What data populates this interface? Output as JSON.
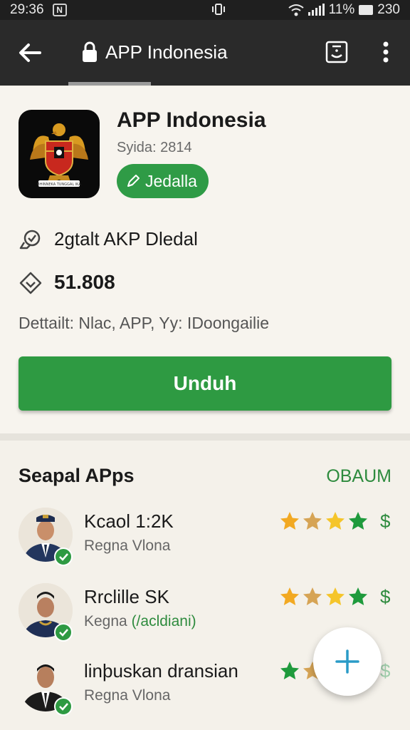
{
  "status_bar": {
    "time": "29:36",
    "notif_letter": "N",
    "battery_percent": "11%",
    "clock_right": "230"
  },
  "app_bar": {
    "title": "APP Indonesia",
    "icons": [
      "back-arrow-icon",
      "lock-icon",
      "share-icon",
      "more-vert-icon"
    ]
  },
  "app": {
    "name": "APP Indonesia",
    "size": "Syida: 2814",
    "verified_label": "Jedalla",
    "developer": "2gtalt  AKP Dledal",
    "downloads": "51.808",
    "details": "Dettailt: Nlac, APP, Yy: IDoongailie",
    "download_button": "Unduh",
    "icon_caption": "BHINNEKA TUNGGAL IKA"
  },
  "similar": {
    "title": "Seapal APps",
    "see_all": "OBAUM",
    "items": [
      {
        "name": "Kcaol 1:2K",
        "subtitle": "Regna Vlona",
        "subtitle_green": false,
        "price": "$",
        "rating": 3.5
      },
      {
        "name": "Rrclille SK",
        "subtitle_prefix": "Kegna ",
        "subtitle_green_part": "(/acldiani)",
        "price": "$",
        "rating": 3.5
      },
      {
        "name": "linþuskan dransian",
        "subtitle": "Regna Vlona",
        "subtitle_green": false,
        "price": "$",
        "rating": 1.5
      }
    ]
  },
  "colors": {
    "primary_green": "#2e9a42",
    "app_bar": "#2a2a2a",
    "status_bar": "#1f1f1f",
    "background": "#f4f1ea",
    "star_gold": "#f2a922",
    "star_green": "#1e9a3c",
    "fab_plus": "#2a9bc7"
  }
}
